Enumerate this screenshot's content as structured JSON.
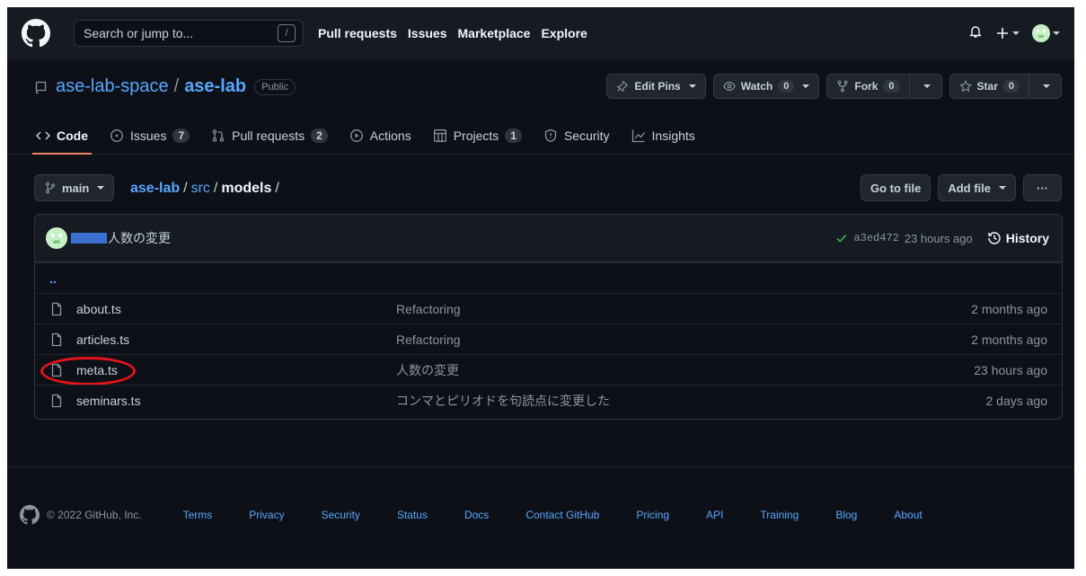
{
  "header": {
    "search_placeholder": "Search or jump to...",
    "search_shortcut": "/",
    "nav": [
      "Pull requests",
      "Issues",
      "Marketplace",
      "Explore"
    ]
  },
  "repo": {
    "owner": "ase-lab-space",
    "separator": "/",
    "name": "ase-lab",
    "visibility": "Public",
    "actions": {
      "edit_pins": "Edit Pins",
      "watch": "Watch",
      "watch_count": "0",
      "fork": "Fork",
      "fork_count": "0",
      "star": "Star",
      "star_count": "0"
    }
  },
  "tabs": [
    {
      "label": "Code",
      "icon": "code-icon"
    },
    {
      "label": "Issues",
      "count": "7",
      "icon": "issue-icon"
    },
    {
      "label": "Pull requests",
      "count": "2",
      "icon": "pull-request-icon"
    },
    {
      "label": "Actions",
      "icon": "play-icon"
    },
    {
      "label": "Projects",
      "count": "1",
      "icon": "project-icon"
    },
    {
      "label": "Security",
      "icon": "shield-icon"
    },
    {
      "label": "Insights",
      "icon": "graph-icon"
    }
  ],
  "path": {
    "branch": "main",
    "root": "ase-lab",
    "segment": "src",
    "current": "models",
    "slash": "/",
    "go_to_file": "Go to file",
    "add_file": "Add file",
    "more": "···"
  },
  "latest_commit": {
    "message": "人数の変更",
    "sha": "a3ed472",
    "time": "23 hours ago",
    "history": "History"
  },
  "parent_dir": "..",
  "files": [
    {
      "name": "about.ts",
      "message": "Refactoring",
      "age": "2 months ago"
    },
    {
      "name": "articles.ts",
      "message": "Refactoring",
      "age": "2 months ago"
    },
    {
      "name": "meta.ts",
      "message": "人数の変更",
      "age": "23 hours ago"
    },
    {
      "name": "seminars.ts",
      "message": "コンマとピリオドを句読点に変更した",
      "age": "2 days ago"
    }
  ],
  "footer": {
    "copyright": "© 2022 GitHub, Inc.",
    "links": [
      "Terms",
      "Privacy",
      "Security",
      "Status",
      "Docs",
      "Contact GitHub",
      "Pricing",
      "API",
      "Training",
      "Blog",
      "About"
    ]
  },
  "colors": {
    "background": "#0d1117",
    "header": "#161b22",
    "link": "#58a6ff",
    "tab_underline": "#f78166",
    "annotation": "#e8121c",
    "success": "#3fb950"
  }
}
